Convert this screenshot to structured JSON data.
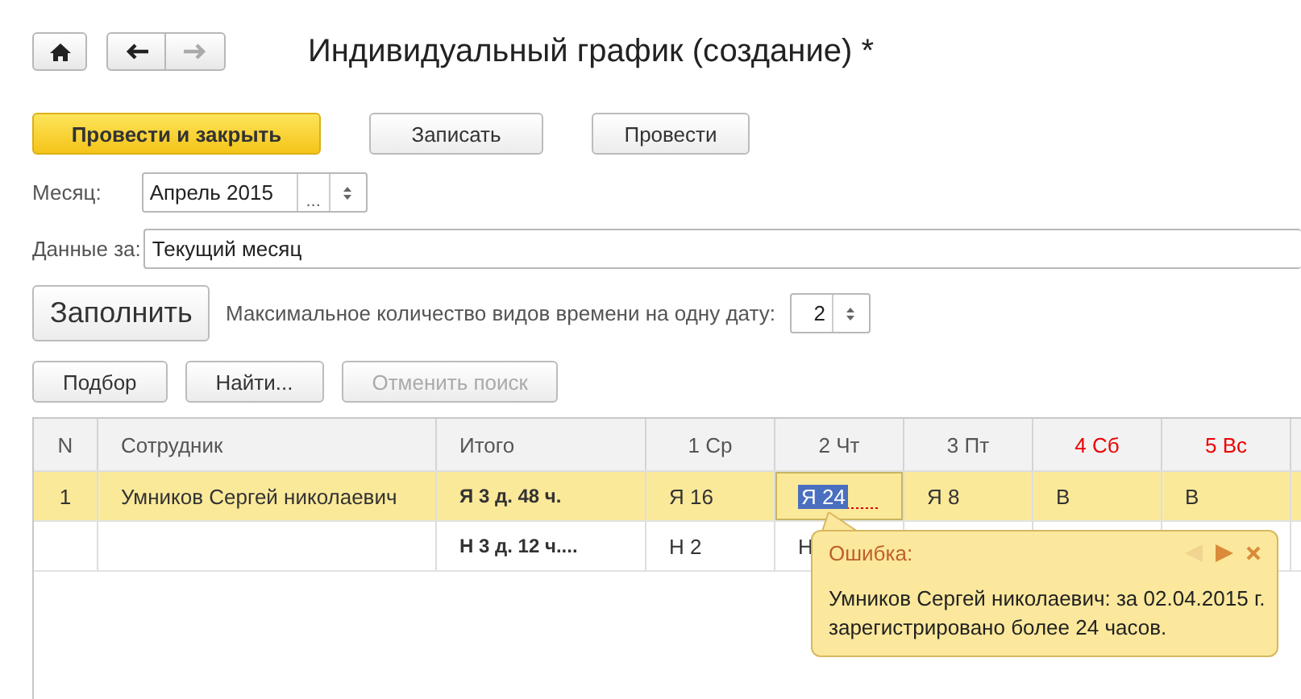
{
  "window": {
    "title": "Индивидуальный график (создание) *"
  },
  "nav": {
    "back_disabled": false,
    "forward_disabled": true
  },
  "actions": [
    {
      "label": "Провести и закрыть",
      "kind": "primary"
    },
    {
      "label": "Записать",
      "kind": "normal"
    },
    {
      "label": "Провести",
      "kind": "normal"
    }
  ],
  "month": {
    "label": "Месяц:",
    "value": "Апрель 2015",
    "select_button": "..."
  },
  "data_for": {
    "label": "Данные за:",
    "value": "Текущий месяц"
  },
  "fill_button": "Заполнить",
  "max_types": {
    "label": "Максимальное количество видов времени на одну дату:",
    "value": "2"
  },
  "table_buttons": [
    {
      "label": "Подбор",
      "disabled": false
    },
    {
      "label": "Найти...",
      "disabled": false
    },
    {
      "label": "Отменить поиск",
      "disabled": true
    }
  ],
  "table": {
    "columns": [
      {
        "label": "N",
        "weekend": false
      },
      {
        "label": "Сотрудник",
        "weekend": false
      },
      {
        "label": "Итого",
        "weekend": false
      },
      {
        "label": "1 Ср",
        "weekend": false
      },
      {
        "label": "2 Чт",
        "weekend": false
      },
      {
        "label": "3 Пт",
        "weekend": false
      },
      {
        "label": "4 Сб",
        "weekend": true
      },
      {
        "label": "5 Вс",
        "weekend": true
      }
    ],
    "rows": [
      {
        "selected": true,
        "cells": [
          {
            "text": "1",
            "active": false,
            "error": false
          },
          {
            "text": "Умников Сергей николаевич",
            "active": false,
            "error": false
          },
          {
            "text": "Я 3 д. 48 ч.",
            "active": false,
            "error": false
          },
          {
            "text": "Я 16",
            "active": false,
            "error": false
          },
          {
            "text": "Я 24",
            "active": true,
            "error": true
          },
          {
            "text": "Я 8",
            "active": false,
            "error": false
          },
          {
            "text": "В",
            "active": false,
            "error": false
          },
          {
            "text": "В",
            "active": false,
            "error": false
          }
        ]
      },
      {
        "selected": false,
        "cells": [
          {
            "text": "",
            "active": false,
            "error": false
          },
          {
            "text": "",
            "active": false,
            "error": false
          },
          {
            "text": "Н 3 д. 12 ч....",
            "active": false,
            "error": false
          },
          {
            "text": "Н 2",
            "active": false,
            "error": false
          },
          {
            "text": "Н",
            "active": false,
            "error": false
          }
        ]
      }
    ]
  },
  "tooltip": {
    "title": "Ошибка:",
    "message": "Умников Сергей николаевич: за 02.04.2015 г. зарегистрировано более 24 часов.",
    "prev_disabled": true,
    "next_disabled": false
  }
}
